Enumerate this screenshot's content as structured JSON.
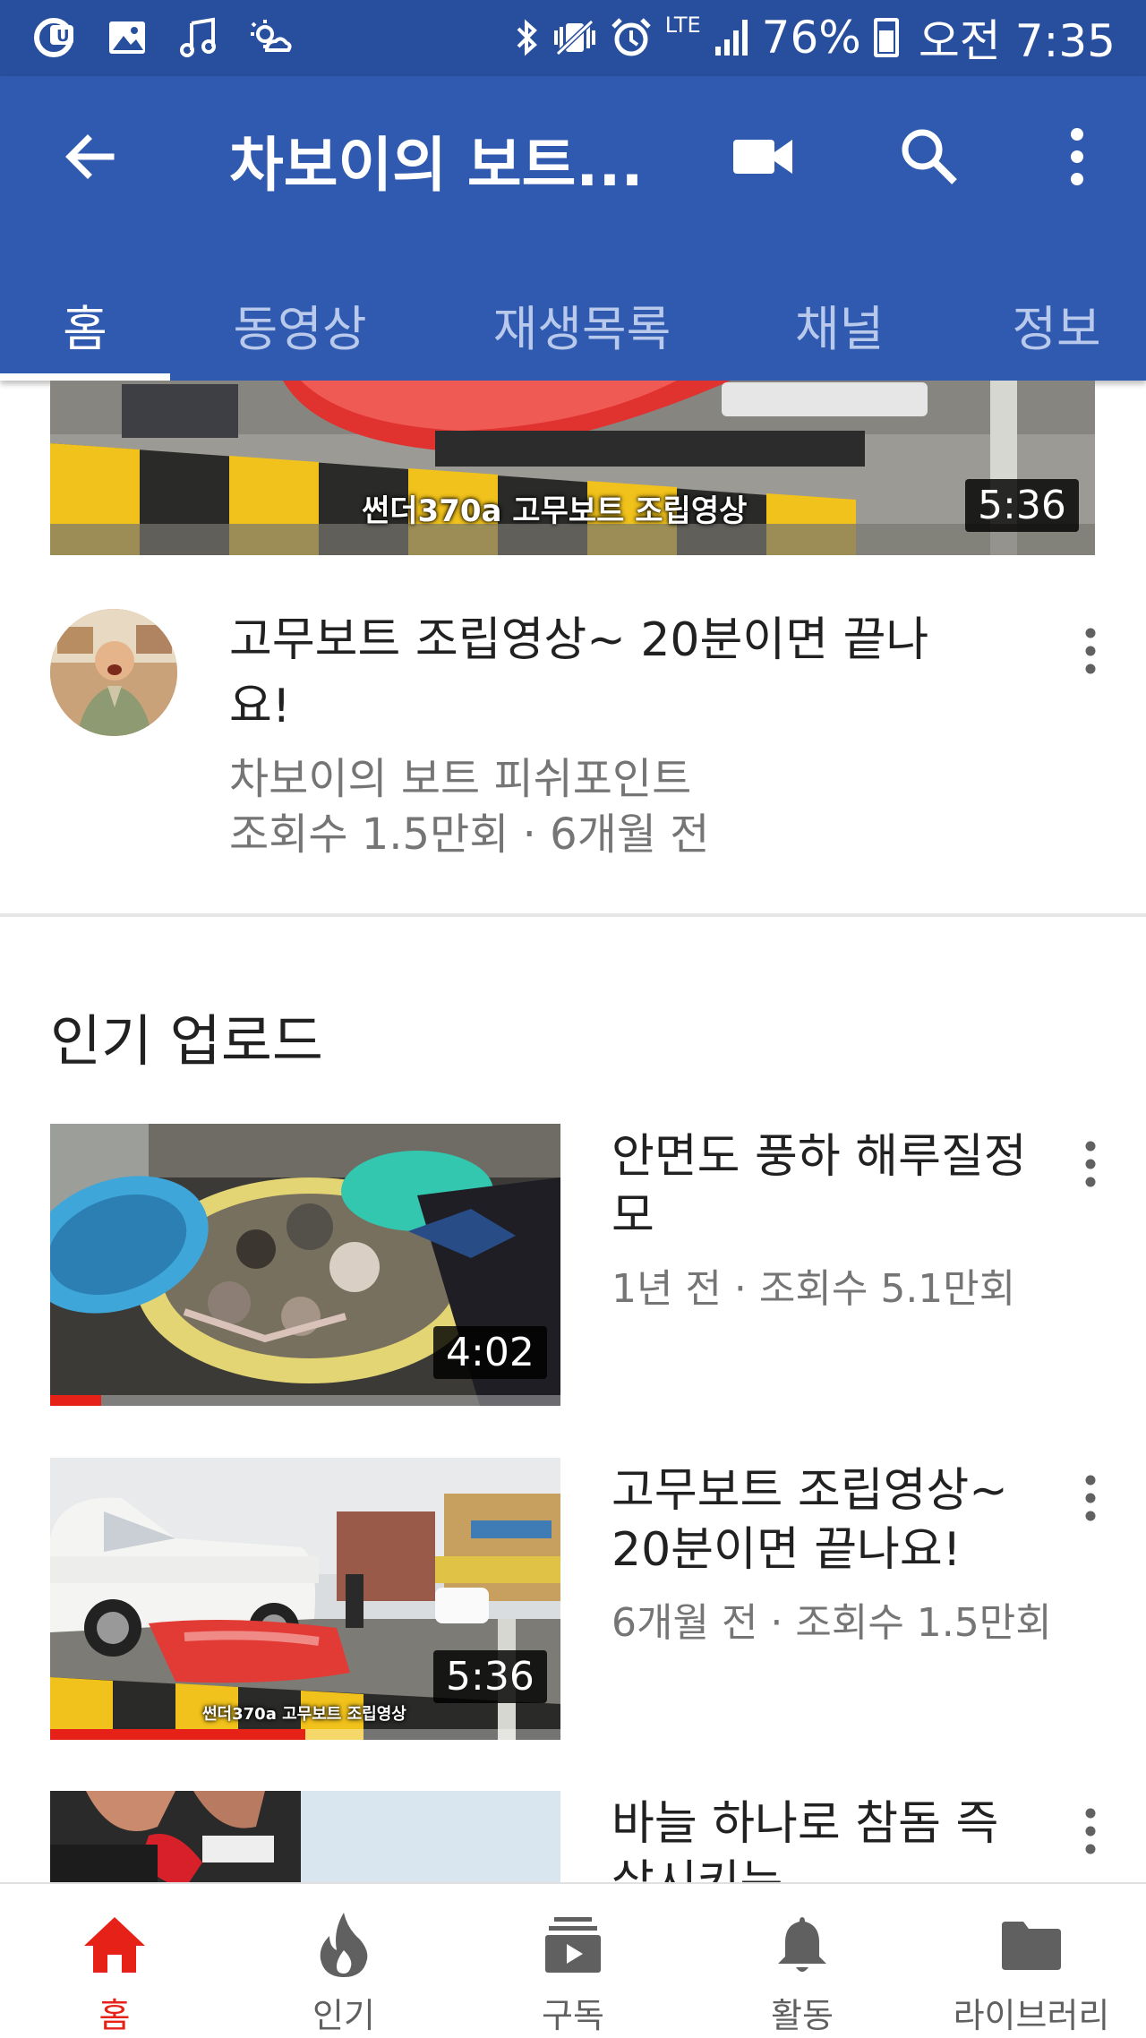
{
  "status_bar": {
    "battery": "76%",
    "time": "오전 7:35",
    "network": "LTE",
    "icons": [
      "u-plus-icon",
      "gallery-icon",
      "music-icon",
      "weather-icon",
      "bluetooth-icon",
      "vibrate-icon",
      "alarm-icon",
      "lte-icon",
      "signal-icon",
      "battery-icon"
    ]
  },
  "app_bar": {
    "title": "차보이의 보트...",
    "icons": [
      "back-arrow-icon",
      "video-camera-icon",
      "search-icon",
      "more-vert-icon"
    ],
    "color": "#2f5ab0"
  },
  "tabs": [
    {
      "label": "홈",
      "active": true
    },
    {
      "label": "동영상",
      "active": false
    },
    {
      "label": "재생목록",
      "active": false
    },
    {
      "label": "채널",
      "active": false
    },
    {
      "label": "정보",
      "active": false
    }
  ],
  "featured": {
    "thumb_caption": "썬더370a 고무보트 조립영상",
    "duration": "5:36",
    "title": "고무보트 조립영상~ 20분이면 끝나요!",
    "channel": "차보이의 보트 피쉬포인트",
    "meta": "조회수 1.5만회 · 6개월 전"
  },
  "section": {
    "title": "인기 업로드"
  },
  "videos": [
    {
      "title": "안면도 풍하 해루질정모",
      "meta": "1년 전 · 조회수 5.1만회",
      "duration": "4:02",
      "progress": 0.1
    },
    {
      "title": "고무보트 조립영상~ 20분이면 끝나요!",
      "meta": "6개월 전 · 조회수 1.5만회",
      "duration": "5:36",
      "progress": 0.5,
      "thumb_caption": "썬더370a 고무보트 조립영상"
    },
    {
      "title": "바늘 하나로 참돔 즉살시키는",
      "meta": "",
      "duration": ""
    }
  ],
  "bottom_nav": [
    {
      "label": "홈",
      "icon": "home-icon",
      "active": true
    },
    {
      "label": "인기",
      "icon": "trending-flame-icon",
      "active": false
    },
    {
      "label": "구독",
      "icon": "subscriptions-icon",
      "active": false
    },
    {
      "label": "활동",
      "icon": "bell-icon",
      "active": false
    },
    {
      "label": "라이브러리",
      "icon": "folder-icon",
      "active": false
    }
  ],
  "colors": {
    "accent_red": "#e62117",
    "header_blue": "#2f5ab0",
    "status_blue": "#284f9d"
  }
}
